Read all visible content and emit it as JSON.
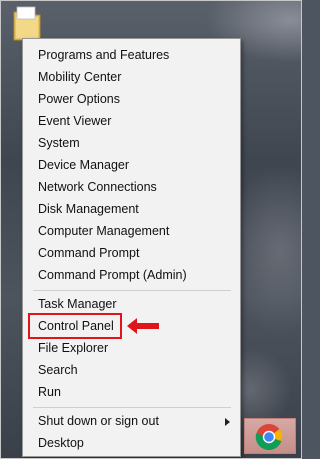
{
  "menu": {
    "items": [
      {
        "label": "Programs and Features",
        "has_submenu": false
      },
      {
        "label": "Mobility Center",
        "has_submenu": false
      },
      {
        "label": "Power Options",
        "has_submenu": false
      },
      {
        "label": "Event Viewer",
        "has_submenu": false
      },
      {
        "label": "System",
        "has_submenu": false
      },
      {
        "label": "Device Manager",
        "has_submenu": false
      },
      {
        "label": "Network Connections",
        "has_submenu": false
      },
      {
        "label": "Disk Management",
        "has_submenu": false
      },
      {
        "label": "Computer Management",
        "has_submenu": false
      },
      {
        "label": "Command Prompt",
        "has_submenu": false
      },
      {
        "label": "Command Prompt (Admin)",
        "has_submenu": false
      },
      {
        "label": "Task Manager",
        "has_submenu": false
      },
      {
        "label": "Control Panel",
        "has_submenu": false,
        "highlighted": true
      },
      {
        "label": "File Explorer",
        "has_submenu": false
      },
      {
        "label": "Search",
        "has_submenu": false
      },
      {
        "label": "Run",
        "has_submenu": false
      },
      {
        "label": "Shut down or sign out",
        "has_submenu": true
      },
      {
        "label": "Desktop",
        "has_submenu": false
      }
    ]
  },
  "colors": {
    "highlight_box": "#e2141b",
    "menu_background": "#f2f2f2"
  },
  "icons": {
    "desktop_folder": "folder-icon",
    "taskbar_app": "chrome-icon"
  }
}
